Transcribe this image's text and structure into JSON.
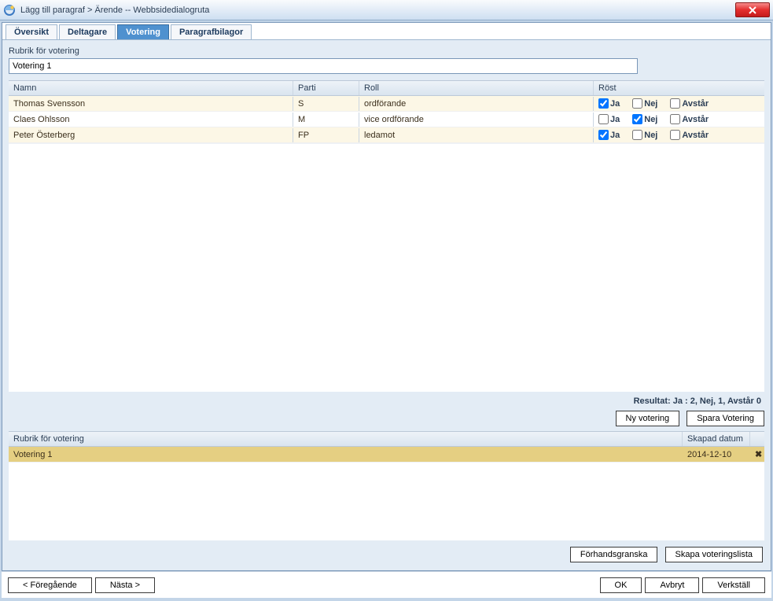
{
  "title": "Lägg till paragraf > Ärende -- Webbsidedialogruta",
  "tabs": {
    "oversikt": "Översikt",
    "deltagare": "Deltagare",
    "votering": "Votering",
    "paragrafbilagor": "Paragrafbilagor"
  },
  "rubrik_label": "Rubrik för votering",
  "rubrik_value": "Votering 1",
  "grid_headers": {
    "namn": "Namn",
    "parti": "Parti",
    "roll": "Roll",
    "rost": "Röst"
  },
  "vote_labels": {
    "ja": "Ja",
    "nej": "Nej",
    "avstar": "Avstår"
  },
  "rows": [
    {
      "namn": "Thomas Svensson",
      "parti": "S",
      "roll": "ordförande",
      "ja": true,
      "nej": false,
      "avstar": false
    },
    {
      "namn": "Claes Ohlsson",
      "parti": "M",
      "roll": "vice ordförande",
      "ja": false,
      "nej": true,
      "avstar": false
    },
    {
      "namn": "Peter Österberg",
      "parti": "FP",
      "roll": "ledamot",
      "ja": true,
      "nej": false,
      "avstar": false
    }
  ],
  "result_text": "Resultat: Ja : 2, Nej, 1, Avstår 0",
  "buttons": {
    "ny_votering": "Ny votering",
    "spara_votering": "Spara Votering",
    "forhandsgranska": "Förhandsgranska",
    "skapa_voteringslista": "Skapa voteringslista",
    "foregaende": "< Föregående",
    "nasta": "Nästa >",
    "ok": "OK",
    "avbryt": "Avbryt",
    "verkstall": "Verkställ"
  },
  "lower_list": {
    "header_rubrik": "Rubrik för votering",
    "header_date": "Skapad datum",
    "row_rubrik": "Votering 1",
    "row_date": "2014-12-10"
  }
}
